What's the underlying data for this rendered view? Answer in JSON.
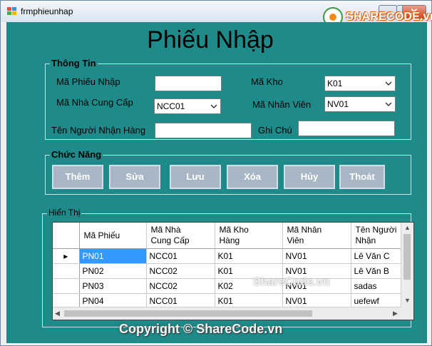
{
  "window": {
    "title": "frmphieunhap"
  },
  "watermark": {
    "brand": "SHARECODE.vn",
    "mid": "ShareCode.vn",
    "copyright": "Copyright © ShareCode.vn"
  },
  "form": {
    "heading": "Phiếu Nhập",
    "info_group": "Thông Tin",
    "fields": {
      "ma_phieu_nhap": {
        "label": "Mã Phiếu Nhập",
        "value": ""
      },
      "ma_kho": {
        "label": "Mã Kho",
        "value": "K01"
      },
      "ma_ncc": {
        "label": "Mã Nhà Cung Cấp",
        "value": "NCC01"
      },
      "ma_nv": {
        "label": "Mã Nhân Viên",
        "value": "NV01"
      },
      "ten_nguoi_nhan": {
        "label": "Tên Người Nhận Hàng",
        "value": ""
      },
      "ghi_chu": {
        "label": "Ghi Chú",
        "value": ""
      }
    },
    "func_group": "Chức Năng",
    "buttons": {
      "add": "Thêm",
      "edit": "Sửa",
      "save": "Lưu",
      "delete": "Xóa",
      "cancel": "Hủy",
      "exit": "Thoát"
    },
    "display_group": "Hiển Thị"
  },
  "grid": {
    "columns": [
      "Mã Phiếu",
      "Mã Nhà\nCung Cấp",
      "Mã Kho\nHàng",
      "Mã Nhân\nViên",
      "Tên Người\nNhận"
    ],
    "rows": [
      [
        "PN01",
        "NCC01",
        "K01",
        "NV01",
        "Lê Văn C"
      ],
      [
        "PN02",
        "NCC02",
        "K01",
        "NV01",
        "Lê Văn B"
      ],
      [
        "PN03",
        "NCC02",
        "K02",
        "NV01",
        "sadas"
      ],
      [
        "PN04",
        "NCC01",
        "K01",
        "NV01",
        "uefewf"
      ]
    ],
    "current_row_marker": "▸"
  },
  "colors": {
    "client_bg": "#1e8a8a",
    "button_bg": "#a9b6c6",
    "selection": "#3399ff"
  }
}
